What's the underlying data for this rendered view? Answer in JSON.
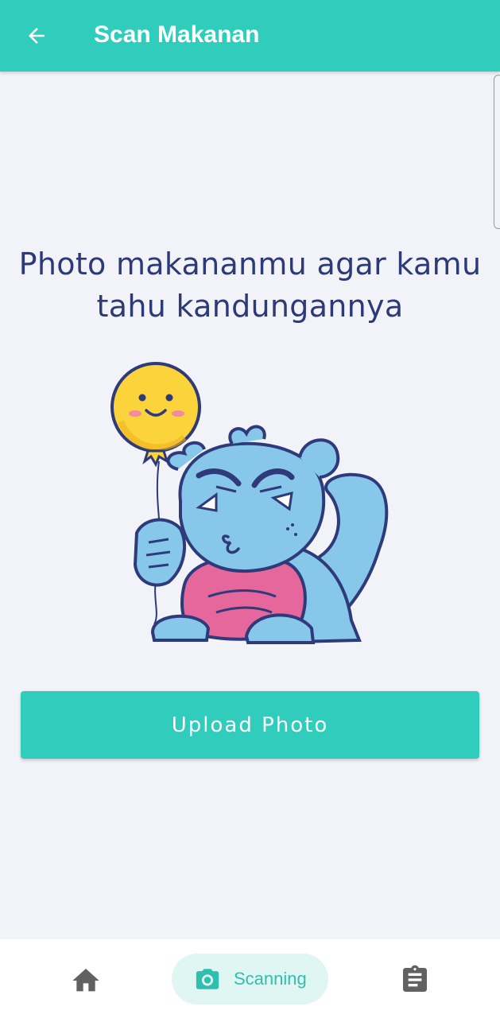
{
  "app_bar": {
    "title": "Scan Makanan",
    "back_icon": "arrow-left-icon"
  },
  "main": {
    "headline_line1": "Photo makananmu agar kamu",
    "headline_line2": "tahu kandungannya",
    "illustration": "monster-holding-smiley-balloon",
    "upload_button_label": "Upload Photo"
  },
  "bottom_nav": {
    "items": [
      {
        "icon": "home-icon",
        "label": ""
      },
      {
        "icon": "camera-icon",
        "label": "Scanning",
        "active": true
      },
      {
        "icon": "clipboard-icon",
        "label": ""
      }
    ]
  },
  "colors": {
    "primary": "#30cdbc",
    "headline": "#2e3a78",
    "background": "#f2f3f9",
    "nav_active_bg": "#e0f6f3"
  }
}
